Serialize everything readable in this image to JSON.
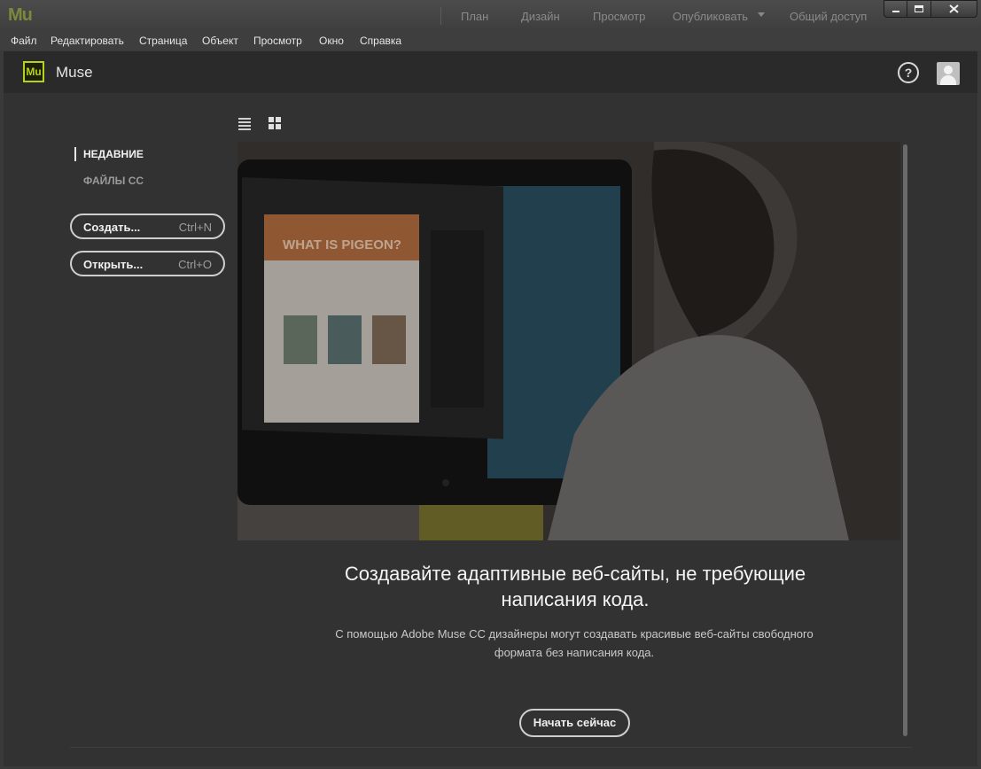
{
  "titlebar": {
    "app_logo": "Mu",
    "workspaces": [
      "План",
      "Дизайн",
      "Просмотр",
      "Опубликовать",
      "Общий доступ"
    ]
  },
  "menubar": {
    "items": [
      "Файл",
      "Редактировать",
      "Страница",
      "Объект",
      "Просмотр",
      "Окно",
      "Справка"
    ]
  },
  "header": {
    "badge": "Mu",
    "title": "Muse",
    "help_glyph": "?",
    "icons": [
      "help-icon",
      "user-avatar-icon"
    ]
  },
  "sidebar": {
    "nav": [
      {
        "label": "НЕДАВНИЕ",
        "selected": true
      },
      {
        "label": "ФАЙЛЫ CC",
        "selected": false
      }
    ],
    "actions": [
      {
        "label": "Создать...",
        "shortcut": "Ctrl+N"
      },
      {
        "label": "Открыть...",
        "shortcut": "Ctrl+O"
      }
    ]
  },
  "view_toggle": {
    "icons": [
      "list-view-icon",
      "grid-view-icon"
    ]
  },
  "hero": {
    "screen_text": "WHAT IS PIGEON?"
  },
  "promo": {
    "headline_line1": "Создавайте адаптивные веб-сайты, не требующие",
    "headline_line2": "написания кода.",
    "subtext_line1": "С помощью Adobe Muse CC дизайнеры могут создавать красивые веб-сайты свободного",
    "subtext_line2": "формата без написания кода.",
    "cta": "Начать сейчас"
  },
  "colors": {
    "window_bg": "#3a3a3a",
    "panel_bg": "#323232",
    "header_bg": "#2a2a2a",
    "muse_accent": "#b8d11d",
    "text": "#f4f4f4"
  }
}
